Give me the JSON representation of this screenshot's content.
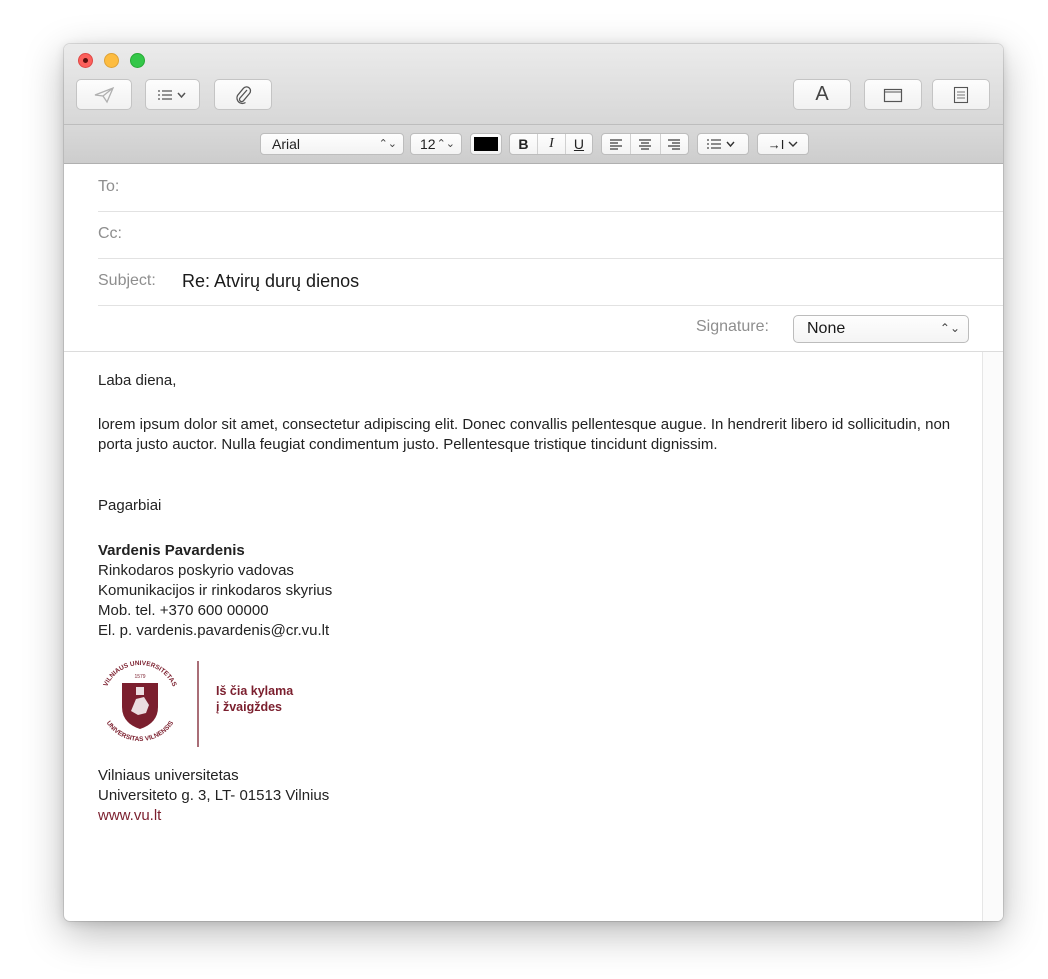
{
  "toolbar": {
    "send_icon": "paper-plane-icon",
    "header_fields_icon": "list-icon",
    "attach_icon": "paperclip-icon",
    "fonts_label": "A",
    "photo_browser_icon": "window-icon",
    "stationery_icon": "stationery-icon"
  },
  "format": {
    "font": "Arial",
    "size": "12",
    "color": "#000000",
    "bold": "B",
    "italic": "I",
    "underline": "U",
    "indent": "→I"
  },
  "headers": {
    "to_label": "To:",
    "to_value": "",
    "cc_label": "Cc:",
    "cc_value": "",
    "subject_label": "Subject:",
    "subject_value": "Re: Atvirų durų dienos",
    "signature_label": "Signature:",
    "signature_value": "None"
  },
  "body": {
    "greeting": "Laba diena,",
    "paragraph": "lorem ipsum dolor sit amet, consectetur adipiscing elit. Donec convallis pellentesque augue. In hendrerit libero id sollicitudin, non porta justo auctor. Nulla feugiat condimentum justo. Pellentesque tristique tincidunt dignissim.",
    "closing": "Pagarbiai"
  },
  "signature": {
    "name": "Vardenis Pavardenis",
    "title": "Rinkodaros poskyrio vadovas",
    "department": "Komunikacijos ir rinkodaros skyrius",
    "phone": "Mob. tel. +370 600 00000",
    "email": "El. p. vardenis.pavardenis@cr.vu.lt",
    "logo_ring_top": "VILNIAUS UNIVERSITETAS",
    "logo_ring_bottom": "UNIVERSITAS VILNENSIS",
    "logo_year": "1579",
    "slogan_line1": "Iš čia kylama",
    "slogan_line2": "į žvaigždes",
    "brand_color": "#7b1f2e",
    "org": "Vilniaus universitetas",
    "address": "Universiteto g. 3, LT- 01513 Vilnius",
    "website": "www.vu.lt"
  }
}
